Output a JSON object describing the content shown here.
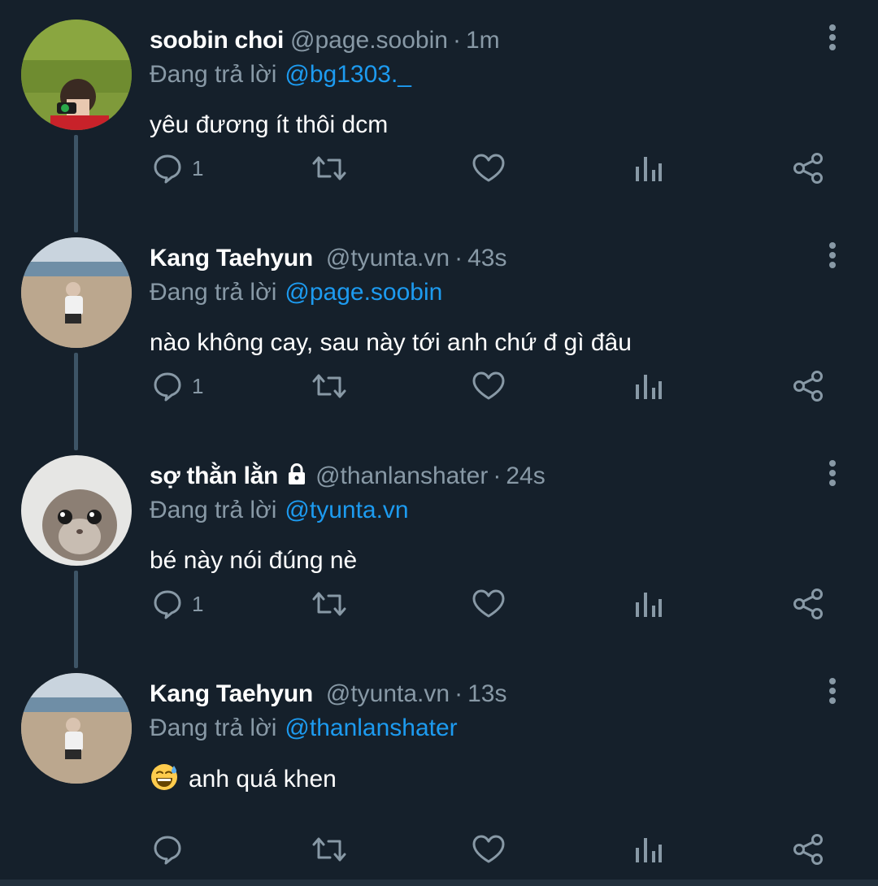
{
  "reply_prefix": "Đang trả lời",
  "tweets": [
    {
      "name": "soobin choi",
      "handle": "@page.soobin",
      "separator": "·",
      "time": "1m",
      "replying_to": "@bg1303._",
      "text": "yêu đương ít thôi dcm",
      "reply_count": "1",
      "avatar": "boy-with-camera-on-grass",
      "locked": false,
      "emoji": ""
    },
    {
      "name": "Kang Taehyun",
      "handle": "@tyunta.vn",
      "separator": "·",
      "time": "43s",
      "replying_to": "@page.soobin",
      "text": "nào không cay, sau này tới anh chứ đ gì đâu",
      "reply_count": "1",
      "avatar": "person-crouching-on-beach",
      "locked": false,
      "emoji": ""
    },
    {
      "name": "sợ thằn lằn",
      "handle": "@thanlanshater",
      "separator": "·",
      "time": "24s",
      "replying_to": "@tyunta.vn",
      "text": "bé này nói đúng nè",
      "reply_count": "1",
      "avatar": "sad-hamster",
      "locked": true,
      "emoji": ""
    },
    {
      "name": "Kang Taehyun",
      "handle": "@tyunta.vn",
      "separator": "·",
      "time": "13s",
      "replying_to": "@thanlanshater",
      "text": "anh quá khen",
      "reply_count": "",
      "avatar": "person-crouching-on-beach",
      "locked": false,
      "emoji": "grinning-sweat-emoji"
    }
  ],
  "colors": {
    "background": "#15202b",
    "secondary_text": "#8899a6",
    "mention": "#1d9bf0",
    "thread_line": "#3d5466"
  }
}
